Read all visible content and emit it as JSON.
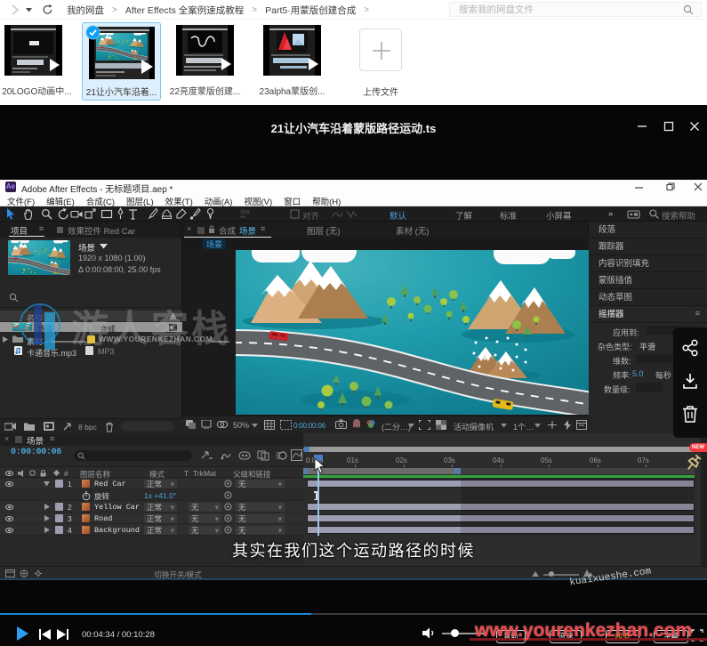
{
  "topbar": {
    "breadcrumbs": [
      "我的网盘",
      "After Effects 全案例速成教程",
      "Part5·用蒙版创建合成"
    ],
    "separator": ">",
    "search_placeholder": "搜索我的网盘文件"
  },
  "thumbs": {
    "items": [
      {
        "label": "20LOGO动画中..."
      },
      {
        "label": "21让小汽车沿着...",
        "selected": true
      },
      {
        "label": "22亮度蒙版创建..."
      },
      {
        "label": "23alpha蒙版创..."
      }
    ],
    "upload_label": "上传文件"
  },
  "player": {
    "title": "21让小汽车沿着蒙版路径运动.ts",
    "subtitle": "其实在我们这个运动路径的时候",
    "corner_watermark": "kuaixueshe.com",
    "site_watermark": "www.yourenkezhan.com",
    "time": "00:04:34 / 00:10:28",
    "progress_percent": 44,
    "accent_color": "#1d86d8",
    "buttons": [
      "音轨",
      "倍速",
      "超清",
      "字幕"
    ],
    "new_badge": "NEW"
  },
  "ae": {
    "title": "Adobe After Effects - 无标题项目.aep *",
    "logo": "Ae",
    "menus": [
      "文件(F)",
      "编辑(E)",
      "合成(C)",
      "图层(L)",
      "效果(T)",
      "动画(A)",
      "视图(V)",
      "窗口",
      "帮助(H)"
    ],
    "workspaces": [
      "默认",
      "了解",
      "标准",
      "小屏幕"
    ],
    "more_icon": "»",
    "help_search": "搜索帮助",
    "snap_label": "对齐",
    "project": {
      "tab": "项目",
      "tab_effects": "效果控件 Red Car",
      "comp_name": "场景",
      "info_line1": "1920 x 1080 (1.00)",
      "info_line2": "Δ 0:00:08:00, 25.00 fps",
      "col_name": "名称",
      "rows": [
        {
          "name": "场景",
          "type": "合成"
        },
        {
          "name": "素材",
          "type": ""
        },
        {
          "name": "卡通音乐.mp3",
          "type": "MP3"
        }
      ],
      "bit_depth": "8 bpc"
    },
    "comp": {
      "tab_prefix": "合成",
      "tab_name": "场景",
      "tab_layer": "图层 (无)",
      "tab_footage": "素材 (无)",
      "nav_chip": "场景",
      "zoom": "50%",
      "timecode": "0:00:00:06",
      "resolution": "(二分…)",
      "camera": "活动摄像机",
      "views": "1个…"
    },
    "dock": {
      "panels": [
        "段落",
        "跟踪器",
        "内容识别填充",
        "蒙版插值",
        "动态草图"
      ],
      "wiggler": {
        "title": "摇摆器",
        "apply_label": "应用到:",
        "noise_label": "杂色类型:",
        "noise_value": "平滑",
        "dims_label": "维数:",
        "freq_label": "频率:",
        "freq_value": "5.0",
        "freq_unit": "每秒",
        "mag_label": "数量级:"
      }
    },
    "timeline": {
      "tab_name": "场景",
      "timecode": "0:00:00:06",
      "col_t": "T",
      "col_name": "图层名称",
      "col_mode": "模式",
      "col_trkmat": "TrkMat",
      "col_parent": "父级和链接",
      "layers": [
        {
          "index": "1",
          "name": "Red Car",
          "mode": "正常",
          "trkmat": "",
          "parent": "无"
        },
        {
          "index": "2",
          "name": "Yellow Car",
          "mode": "正常",
          "trkmat": "无",
          "parent": "无"
        },
        {
          "index": "3",
          "name": "Road",
          "mode": "正常",
          "trkmat": "无",
          "parent": "无"
        },
        {
          "index": "4",
          "name": "Background",
          "mode": "正常",
          "trkmat": "无",
          "parent": "无"
        }
      ],
      "prop_label": "旋转",
      "prop_value": "1x +41.0°",
      "ruler": [
        "0:00s",
        "01s",
        "02s",
        "03s",
        "04s",
        "05s",
        "06s",
        "07s"
      ],
      "toggle_label": "切换开关/模式"
    }
  }
}
